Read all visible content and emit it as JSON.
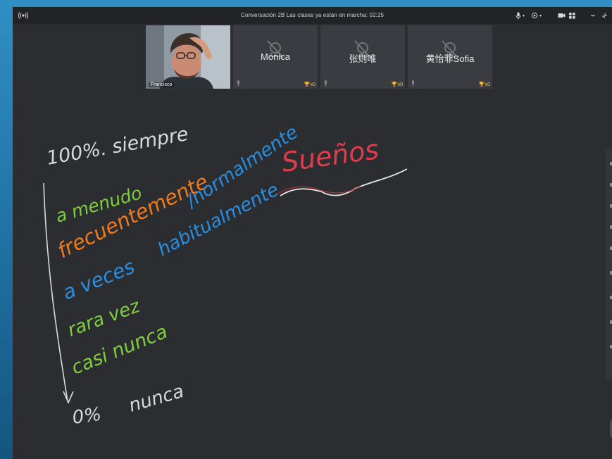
{
  "titlebar": {
    "title": "Conversación 2B   Las clases ya están en marcha: 02:25"
  },
  "participants": [
    {
      "name": "Francisco",
      "video": true,
      "trophies": ""
    },
    {
      "name": "Mónica",
      "video": false,
      "trophies": "x0"
    },
    {
      "name": "张则唯",
      "video": false,
      "trophies": "x0"
    },
    {
      "name": "黄怡菲Sofia",
      "video": false,
      "trophies": "x0"
    }
  ],
  "whiteboard": {
    "lines": {
      "always": "100%. siempre",
      "often": "a menudo",
      "frequently": "frecuentemente",
      "normally": "/normalmente",
      "habitually": "habitualmente",
      "sometimes": "a veces",
      "rarely": "rara vez",
      "almost_never": "casi nunca",
      "zero": "0%",
      "never": "nunca",
      "dreams": "Sueños"
    },
    "colors": {
      "white": "#d9d9d9",
      "green": "#7fcf3d",
      "orange": "#f07a1a",
      "blue": "#2a8ee0",
      "red": "#e23b4a"
    }
  }
}
